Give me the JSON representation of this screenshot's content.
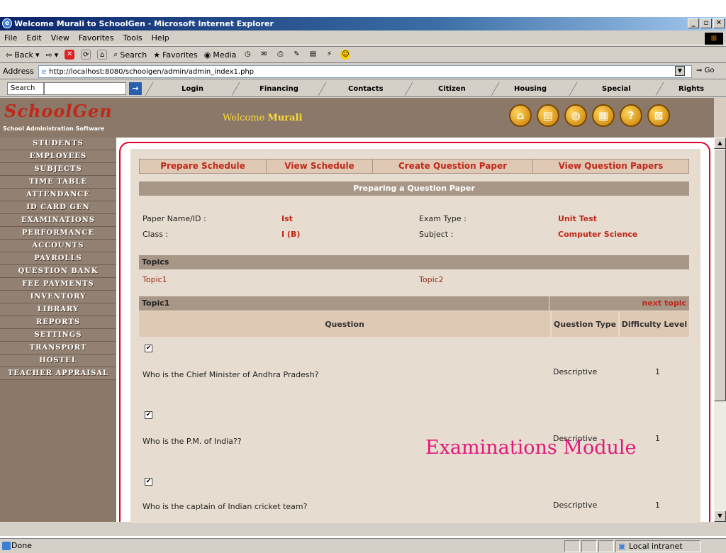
{
  "browser": {
    "title": "Welcome Murali to SchoolGen - Microsoft Internet Explorer",
    "menu": [
      "File",
      "Edit",
      "View",
      "Favorites",
      "Tools",
      "Help"
    ],
    "toolbar": {
      "back": "Back",
      "search": "Search",
      "favorites": "Favorites",
      "media": "Media"
    },
    "address_label": "Address",
    "address": "http://localhost:8080/schoolgen/admin/admin_index1.php",
    "go": "Go",
    "search_label": "Search",
    "link_tabs": [
      "Login",
      "Financing",
      "Contacts",
      "Citizen",
      "Housing",
      "Special",
      "Rights"
    ],
    "status": "Done",
    "zone": "Local intranet"
  },
  "app": {
    "logo": "SchoolGen",
    "logo_sub": "School Administration Software",
    "welcome_prefix": "Welcome",
    "welcome_user": "Murali",
    "header_icons": [
      "home-icon",
      "book-icon",
      "globe-icon",
      "document-icon",
      "help-icon",
      "close-icon"
    ]
  },
  "sidebar": {
    "items": [
      "STUDENTS",
      "EMPLOYEES",
      "SUBJECTS",
      "TIME TABLE",
      "ATTENDANCE",
      "ID CARD GEN",
      "EXAMINATIONS",
      "PERFORMANCE",
      "ACCOUNTS",
      "PAYROLLS",
      "QUESTION BANK",
      "FEE PAYMENTS",
      "INVENTORY",
      "LIBRARY",
      "REPORTS",
      "SETTINGS",
      "TRANSPORT",
      "HOSTEL",
      "TEACHER APPRAISAL"
    ]
  },
  "main": {
    "tabs": [
      "Prepare Schedule",
      "View Schedule",
      "Create Question Paper",
      "View Question Papers"
    ],
    "section_title": "Preparing a Question Paper",
    "paper_name_label": "Paper Name/ID :",
    "paper_name": "Ist",
    "exam_type_label": "Exam Type :",
    "exam_type": "Unit Test",
    "class_label": "Class :",
    "class": "I (B)",
    "subject_label": "Subject :",
    "subject": "Computer Science",
    "topics_header": "Topics",
    "topics": [
      "Topic1",
      "Topic2"
    ],
    "current_topic": "Topic1",
    "next_topic": "next topic",
    "col_question": "Question",
    "col_type": "Question Type",
    "col_difficulty": "Difficulty Level",
    "questions": [
      {
        "text": "Who is the Chief Minister of Andhra Pradesh?",
        "type": "Descriptive",
        "difficulty": "1"
      },
      {
        "text": "Who is the P.M. of India??",
        "type": "Descriptive",
        "difficulty": "1"
      },
      {
        "text": "Who is the captain of Indian cricket team?",
        "type": "Descriptive",
        "difficulty": "1"
      }
    ]
  },
  "watermark": "Examinations Module"
}
